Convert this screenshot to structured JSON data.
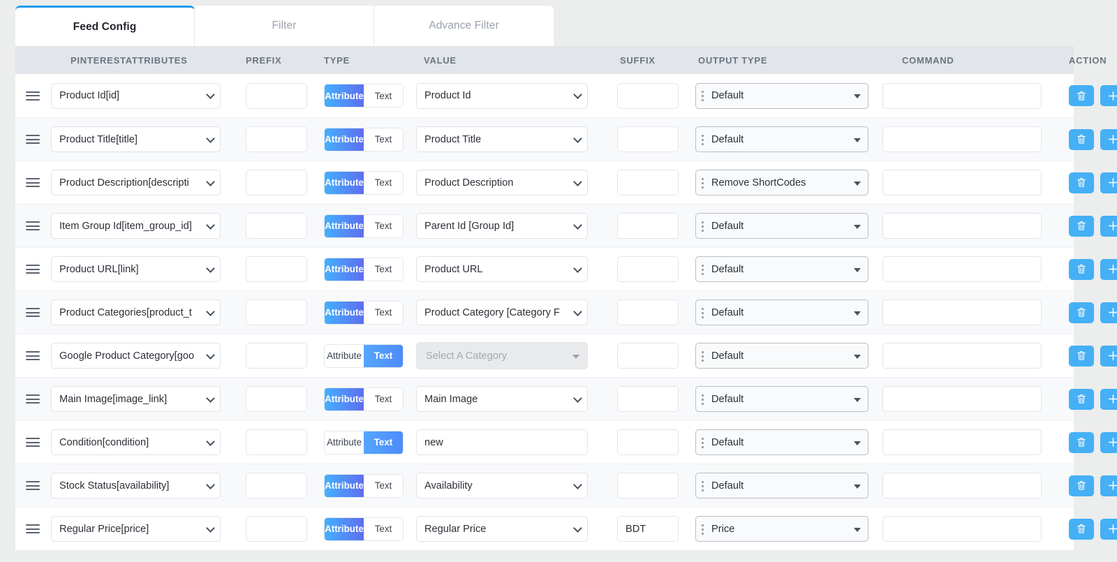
{
  "tabs": [
    {
      "label": "Feed Config",
      "active": true
    },
    {
      "label": "Filter",
      "active": false
    },
    {
      "label": "Advance Filter",
      "active": false
    }
  ],
  "columns": {
    "attributes": "PINTERESTATTRIBUTES",
    "prefix": "PREFIX",
    "type": "TYPE",
    "value": "VALUE",
    "suffix": "SUFFIX",
    "output_type": "OUTPUT TYPE",
    "command": "COMMAND",
    "action": "ACTION"
  },
  "toggle": {
    "attribute_label": "Attribute",
    "text_label": "Text"
  },
  "colors": {
    "accent": "#45b0f5",
    "tab_active_border": "#1f9bf0",
    "toggle_gradient_start": "#44b0fd",
    "toggle_gradient_end": "#5f6df0",
    "header_bg": "#e2e5ea",
    "page_bg": "#eceded",
    "row_alt_bg": "#f8f9fb"
  },
  "icons": {
    "drag_handle": "drag-handle-icon",
    "delete": "trash-icon",
    "add": "plus-icon",
    "chevron": "chevron-down-icon"
  },
  "rows": [
    {
      "attribute": "Product Id[id]",
      "prefix": "",
      "type": "Attribute",
      "value_kind": "select",
      "value": "Product Id",
      "suffix": "",
      "output_type": "Default",
      "command": ""
    },
    {
      "attribute": "Product Title[title]",
      "prefix": "",
      "type": "Attribute",
      "value_kind": "select",
      "value": "Product Title",
      "suffix": "",
      "output_type": "Default",
      "command": ""
    },
    {
      "attribute": "Product Description[descripti",
      "prefix": "",
      "type": "Attribute",
      "value_kind": "select",
      "value": "Product Description",
      "suffix": "",
      "output_type": "Remove ShortCodes",
      "command": ""
    },
    {
      "attribute": "Item Group Id[item_group_id]",
      "prefix": "",
      "type": "Attribute",
      "value_kind": "select",
      "value": "Parent Id [Group Id]",
      "suffix": "",
      "output_type": "Default",
      "command": ""
    },
    {
      "attribute": "Product URL[link]",
      "prefix": "",
      "type": "Attribute",
      "value_kind": "select",
      "value": "Product URL",
      "suffix": "",
      "output_type": "Default",
      "command": ""
    },
    {
      "attribute": "Product Categories[product_t",
      "prefix": "",
      "type": "Attribute",
      "value_kind": "select",
      "value": "Product Category [Category F",
      "suffix": "",
      "output_type": "Default",
      "command": ""
    },
    {
      "attribute": "Google Product Category[goo",
      "prefix": "",
      "type": "Text",
      "value_kind": "disabled-select",
      "value": "Select A Category",
      "suffix": "",
      "output_type": "Default",
      "command": ""
    },
    {
      "attribute": "Main Image[image_link]",
      "prefix": "",
      "type": "Attribute",
      "value_kind": "select",
      "value": "Main Image",
      "suffix": "",
      "output_type": "Default",
      "command": ""
    },
    {
      "attribute": "Condition[condition]",
      "prefix": "",
      "type": "Text",
      "value_kind": "input",
      "value": "new",
      "suffix": "",
      "output_type": "Default",
      "command": ""
    },
    {
      "attribute": "Stock Status[availability]",
      "prefix": "",
      "type": "Attribute",
      "value_kind": "select",
      "value": "Availability",
      "suffix": "",
      "output_type": "Default",
      "command": ""
    },
    {
      "attribute": "Regular Price[price]",
      "prefix": "",
      "type": "Attribute",
      "value_kind": "select",
      "value": "Regular Price",
      "suffix": "BDT",
      "output_type": "Price",
      "command": ""
    }
  ]
}
